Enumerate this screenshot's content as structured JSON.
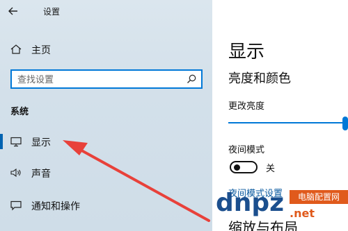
{
  "window": {
    "title": "设置"
  },
  "sidebar": {
    "home_label": "主页",
    "search": {
      "placeholder": "查找设置"
    },
    "section_label": "系统",
    "items": [
      {
        "label": "显示",
        "icon": "monitor-icon",
        "active": true
      },
      {
        "label": "声音",
        "icon": "speaker-icon",
        "active": false
      },
      {
        "label": "通知和操作",
        "icon": "notification-icon",
        "active": false
      }
    ]
  },
  "main": {
    "title": "显示",
    "subtitle": "亮度和颜色",
    "brightness_label": "更改亮度",
    "brightness_value": 1.0,
    "night_mode_label": "夜间模式",
    "night_mode_state": "关",
    "night_mode_link": "夜间模式设置",
    "cut_text": "缩放与布局"
  },
  "watermark": {
    "brand": "dnpz",
    "cn": "电脑配置网",
    "domain": ".net"
  },
  "colors": {
    "accent": "#0078d7",
    "sidebar_bg": "#d6e2eb",
    "arrow": "#e8413a",
    "link": "#0a5aa0"
  }
}
